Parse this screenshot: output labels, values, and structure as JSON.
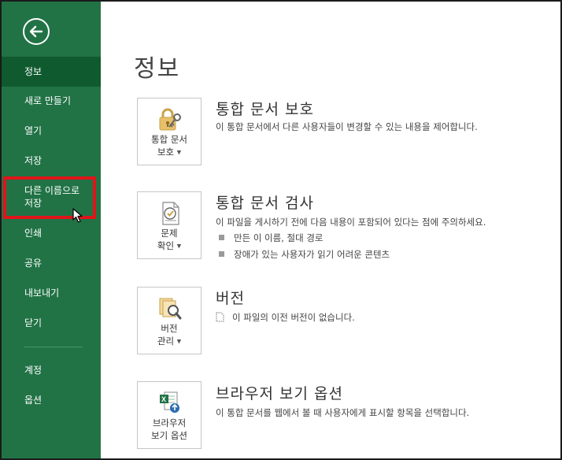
{
  "colors": {
    "sidebar_bg": "#217346",
    "sidebar_active": "#0f5a2e",
    "highlight": "#e0141a",
    "text": "#444444"
  },
  "sidebar": {
    "back_icon": "back-arrow-icon",
    "items": [
      {
        "label": "정보",
        "active": true
      },
      {
        "label": "새로 만들기"
      },
      {
        "label": "열기"
      },
      {
        "label": "저장"
      },
      {
        "label": "다른 이름으로 저장",
        "line1": "다른 이름으로",
        "line2": "저장",
        "highlighted": true
      },
      {
        "label": "인쇄"
      },
      {
        "label": "공유"
      },
      {
        "label": "내보내기"
      },
      {
        "label": "닫기"
      },
      {
        "label": "계정"
      },
      {
        "label": "옵션"
      }
    ]
  },
  "main": {
    "title": "정보",
    "sections": [
      {
        "tile_line1": "통합 문서",
        "tile_line2": "보호",
        "icon": "lock-key-icon",
        "title": "통합 문서 보호",
        "desc": "이 통합 문서에서 다른 사용자들이 변경할 수 있는 내용을 제어합니다."
      },
      {
        "tile_line1": "문제",
        "tile_line2": "확인",
        "icon": "check-document-icon",
        "title": "통합 문서 검사",
        "desc": "이 파일을 게시하기 전에 다음 내용이 포함되어 있다는 점에 주의하세요.",
        "bullets": [
          "만든 이 이름, 절대 경로",
          "장애가 있는 사용자가 읽기 어려운 콘텐츠"
        ]
      },
      {
        "tile_line1": "버전",
        "tile_line2": "관리",
        "icon": "versions-search-icon",
        "title": "버전",
        "note": "이 파일의 이전 버전이 없습니다."
      },
      {
        "tile_line1": "브라우저",
        "tile_line2": "보기 옵션",
        "icon": "excel-browser-icon",
        "title": "브라우저 보기 옵션",
        "desc": "이 통합 문서를 웹에서 볼 때 사용자에게 표시할 항목을 선택합니다."
      }
    ]
  }
}
